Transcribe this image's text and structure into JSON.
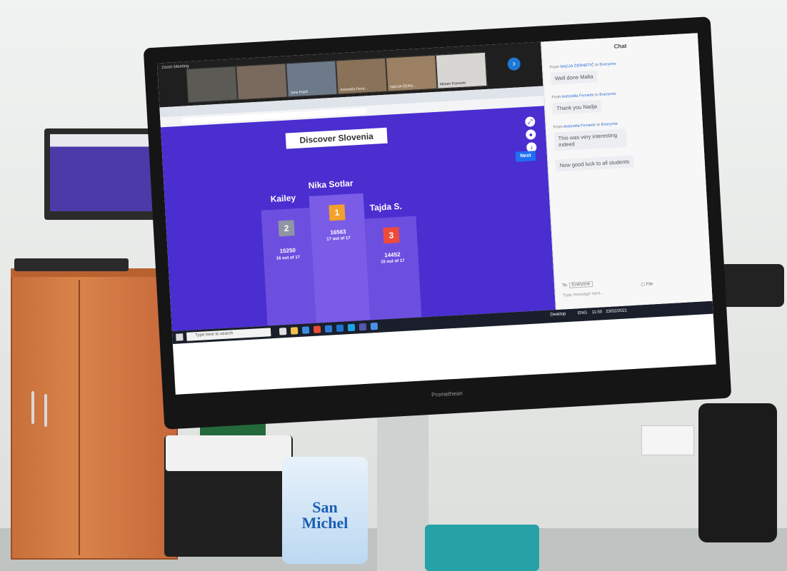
{
  "meeting": {
    "window_title": "Zoom Meeting",
    "participants": [
      {
        "name": ""
      },
      {
        "name": ""
      },
      {
        "name": "Jana Kopič"
      },
      {
        "name": "Antonella Ferra..."
      },
      {
        "name": "NADJA ČERN..."
      },
      {
        "name": "Miriam Francotti"
      }
    ]
  },
  "quiz": {
    "title": "Discover Slovenia",
    "next_label": "Next",
    "podium": [
      {
        "rank": "2",
        "name": "Kailey",
        "score": "15250",
        "count": "16 out of 17",
        "color": "#8f95a3"
      },
      {
        "rank": "1",
        "name": "Nika Sotlar",
        "score": "16563",
        "count": "17 out of 17",
        "color": "#f3a12b"
      },
      {
        "rank": "3",
        "name": "Tajda S.",
        "score": "14452",
        "count": "15 out of 17",
        "color": "#ee4b3a"
      }
    ]
  },
  "chat": {
    "title": "Chat",
    "messages": [
      {
        "from": "NADJA ČERNETIČ",
        "to": "Everyone",
        "text": "Well done Malta"
      },
      {
        "from": "Antonella Ferrante",
        "to": "Everyone",
        "text": "Thank you Nadja"
      },
      {
        "from": "Antonella Ferrante",
        "to": "Everyone",
        "text": "This was very interesting indeed"
      },
      {
        "from": "",
        "to": "",
        "text": "Now good luck to all students"
      }
    ],
    "to_label": "To:",
    "to_value": "Everyone",
    "input_placeholder": "Type message here...",
    "file_label": "File"
  },
  "taskbar": {
    "search_placeholder": "Type here to search",
    "desktop_label": "Desktop",
    "language": "ENG",
    "time": "11:50",
    "date": "23/02/2021"
  },
  "panel_brand": "Promethean",
  "water_label": "San Michel",
  "colors": {
    "quiz_background": "#4a2ed0",
    "podium": "#6d4fe0",
    "accent": "#1f6ff2"
  }
}
